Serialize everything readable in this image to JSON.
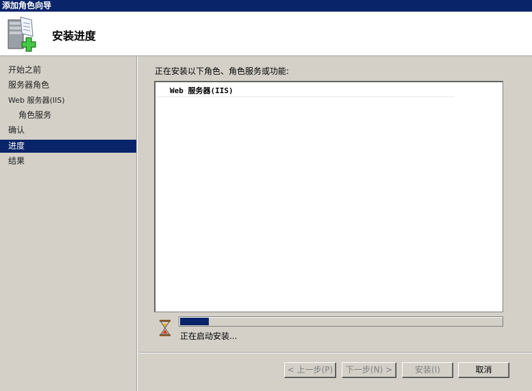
{
  "window": {
    "title": "添加角色向导"
  },
  "header": {
    "title": "安装进度",
    "icon": "server-add-icon"
  },
  "sidebar": {
    "items": [
      {
        "label": "开始之前"
      },
      {
        "label": "服务器角色"
      },
      {
        "label": "Web 服务器(IIS)"
      },
      {
        "label": "角色服务"
      },
      {
        "label": "确认"
      },
      {
        "label": "进度"
      },
      {
        "label": "结果"
      }
    ]
  },
  "main": {
    "intro": "正在安装以下角色、角色服务或功能:",
    "list": [
      {
        "label": "Web 服务器(IIS)"
      }
    ],
    "progress": {
      "fraction": 0.09,
      "icon": "hourglass-icon"
    },
    "status": "正在启动安装..."
  },
  "footer": {
    "prev_label": "< 上一步(P)",
    "next_label": "下一步(N) >",
    "install_label": "安装(I)",
    "cancel_label": "取消"
  },
  "colors": {
    "titlebar": "#0a246a",
    "selected": "#0a246a",
    "background": "#d4d0c8"
  }
}
